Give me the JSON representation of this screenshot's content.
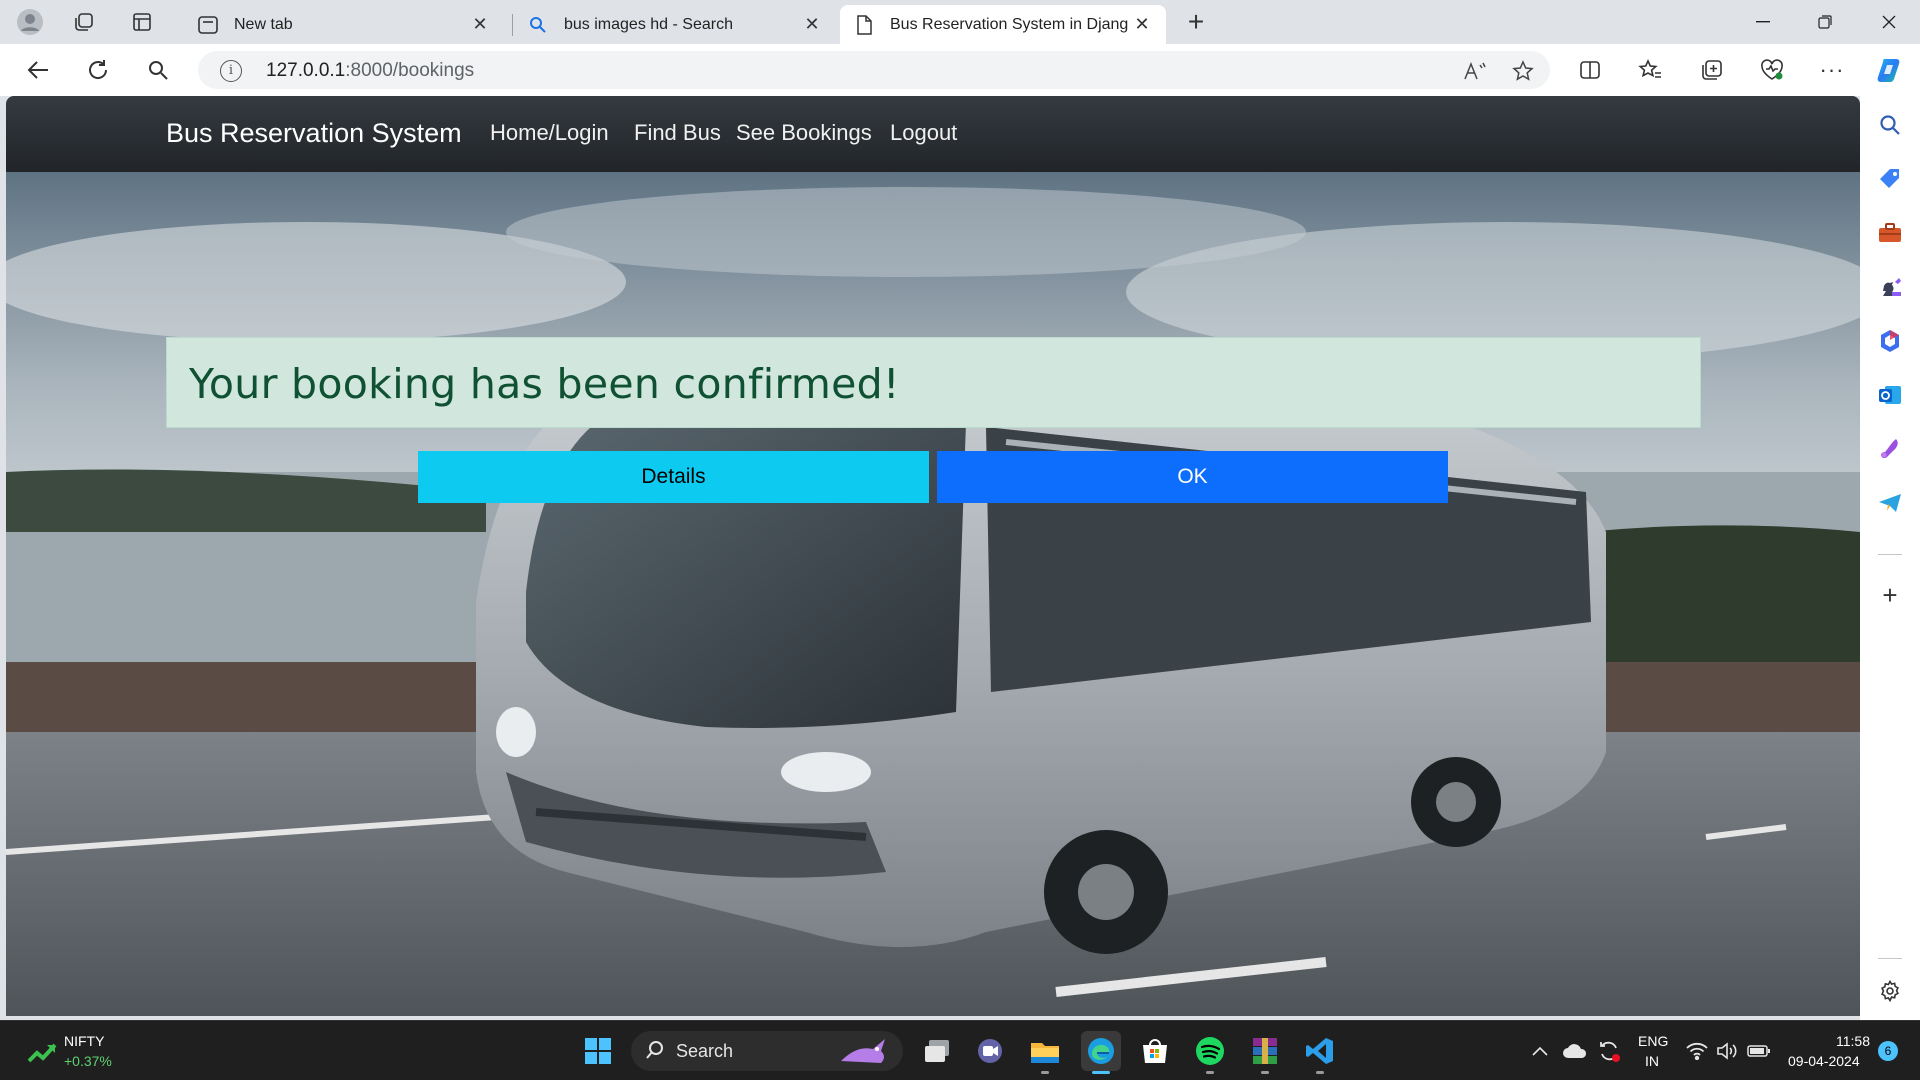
{
  "browser": {
    "tabs": [
      {
        "title": "New tab",
        "icon": "new-tab-icon"
      },
      {
        "title": "bus images hd - Search",
        "icon": "search-icon"
      },
      {
        "title": "Bus Reservation System in Djang",
        "icon": "page-icon",
        "active": true
      }
    ],
    "address": {
      "host": "127.0.0.1",
      "path": ":8000/bookings"
    }
  },
  "page": {
    "brand": "Bus Reservation System",
    "nav": [
      "Home/Login",
      "Find Bus",
      "See Bookings",
      "Logout"
    ],
    "alert_message": "Your booking has been confirmed!",
    "buttons": {
      "details": "Details",
      "ok": "OK"
    },
    "colors": {
      "navbar": "#212529",
      "alert_bg": "#d1e7dd",
      "alert_text": "#0f5132",
      "details_btn": "#0dcaf0",
      "ok_btn": "#0d6efd"
    }
  },
  "taskbar": {
    "widget": {
      "name": "NIFTY",
      "change": "+0.37%"
    },
    "search_label": "Search",
    "language": {
      "line1": "ENG",
      "line2": "IN"
    },
    "clock": {
      "time": "11:58",
      "date": "09-04-2024"
    },
    "notification_count": "6"
  }
}
